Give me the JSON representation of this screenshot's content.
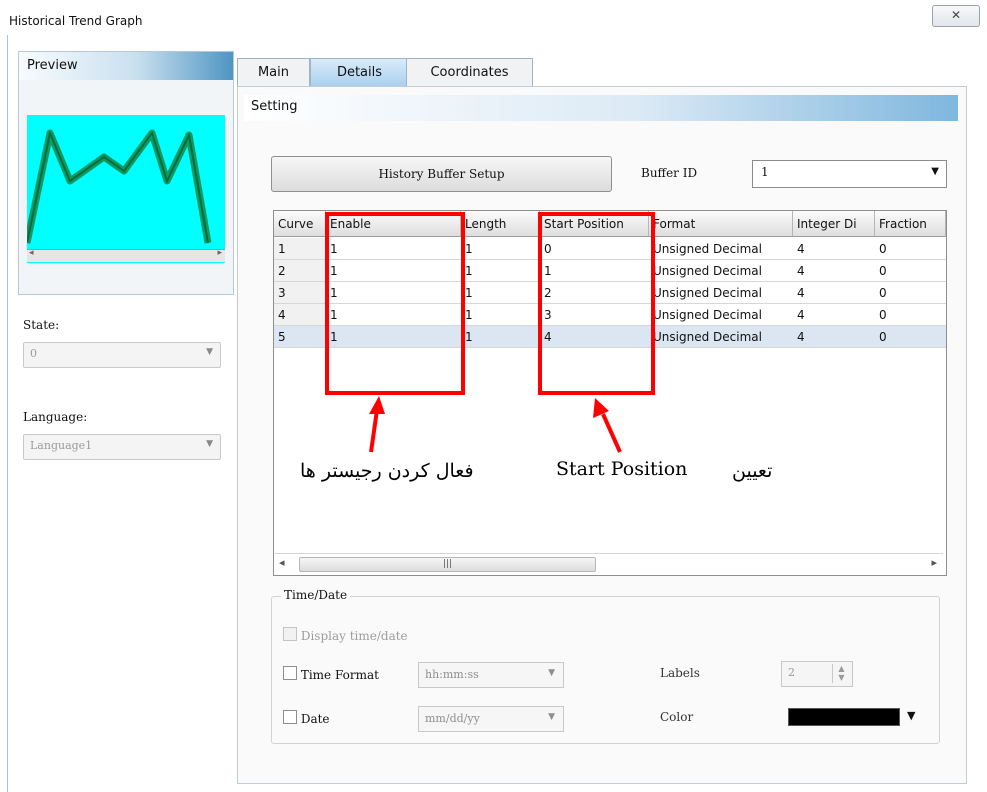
{
  "window": {
    "title": "Historical Trend Graph",
    "close": "✕"
  },
  "preview": {
    "title": "Preview",
    "scroll_left": "◂",
    "scroll_right": "▸"
  },
  "state": {
    "label": "State:",
    "value": "0"
  },
  "language": {
    "label": "Language:",
    "value": "Language1"
  },
  "tabs": [
    {
      "label": "Main",
      "active": false
    },
    {
      "label": "Details",
      "active": true
    },
    {
      "label": "Coordinates",
      "active": false
    }
  ],
  "setting": {
    "section_label": "Setting",
    "history_button": "History Buffer Setup",
    "buffer_id_label": "Buffer ID",
    "buffer_id_value": "1"
  },
  "grid": {
    "columns": [
      "Curve",
      "Enable",
      "Length",
      "Start Position",
      "Format",
      "Integer Di",
      "Fraction"
    ],
    "rows": [
      [
        "1",
        "1",
        "1",
        "0",
        "Unsigned Decimal",
        "4",
        "0"
      ],
      [
        "2",
        "1",
        "1",
        "1",
        "Unsigned Decimal",
        "4",
        "0"
      ],
      [
        "3",
        "1",
        "1",
        "2",
        "Unsigned Decimal",
        "4",
        "0"
      ],
      [
        "4",
        "1",
        "1",
        "3",
        "Unsigned Decimal",
        "4",
        "0"
      ],
      [
        "5",
        "1",
        "1",
        "4",
        "Unsigned Decimal",
        "4",
        "0"
      ]
    ],
    "selected_row": 5,
    "scroll_left": "◂",
    "scroll_thumb": "|||",
    "scroll_right": "▸"
  },
  "annotations": {
    "left": "فعال کردن رجیستر ها",
    "right_prefix": "تعیین",
    "right_english": "Start Position",
    "highlight_color": "#ff0000"
  },
  "time_date": {
    "group_title": "Time/Date",
    "display_label": "Display time/date",
    "time_format_label": "Time Format",
    "time_format_value": "hh:mm:ss",
    "labels_label": "Labels",
    "labels_value": "2",
    "date_label": "Date",
    "date_value": "mm/dd/yy",
    "color_label": "Color",
    "color_value": "#000000"
  }
}
